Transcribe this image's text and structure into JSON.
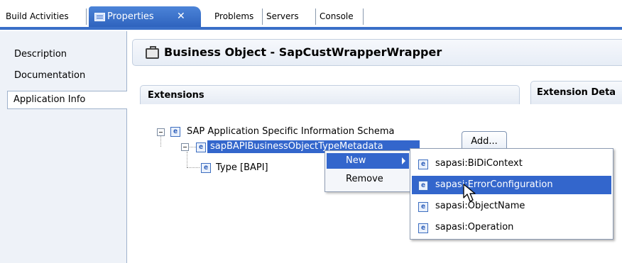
{
  "tabs": [
    {
      "label": "Build Activities"
    },
    {
      "label": "Properties"
    },
    {
      "label": "Problems"
    },
    {
      "label": "Servers"
    },
    {
      "label": "Console"
    }
  ],
  "tab_close_glyph": "✕",
  "nav": {
    "items": [
      {
        "label": "Description"
      },
      {
        "label": "Documentation"
      },
      {
        "label": "Application Info"
      }
    ],
    "selected": "Application Info"
  },
  "header": {
    "title": "Business Object - SapCustWrapperWrapper",
    "icon": "briefcase-icon"
  },
  "extensions": {
    "title": "Extensions",
    "details_title": "Extension Deta",
    "add_button": "Add...",
    "tree": [
      {
        "label": "SAP Application Specific Information Schema",
        "icon": "element-icon",
        "expanded": true
      },
      {
        "label": "sapBAPIBusinessObjectTypeMetadata",
        "icon": "element-icon",
        "expanded": true,
        "selected": true
      },
      {
        "label": "Type [BAPI]",
        "icon": "element-icon"
      }
    ]
  },
  "context_menu": {
    "items": [
      {
        "label": "New",
        "has_submenu": true,
        "highlighted": true
      },
      {
        "label": "Remove"
      }
    ]
  },
  "submenu": {
    "items": [
      {
        "label": "sapasi:BiDiContext",
        "icon": "element-icon"
      },
      {
        "label": "sapasi:ErrorConfiguration",
        "icon": "element-icon",
        "highlighted": true
      },
      {
        "label": "sapasi:ObjectName",
        "icon": "element-icon"
      },
      {
        "label": "sapasi:Operation",
        "icon": "element-icon"
      }
    ]
  },
  "element_icon_glyph": "e",
  "colors": {
    "accent": "#3366cc",
    "tab_active": "#3a6fc8",
    "panel_bg": "#eef2f8"
  }
}
